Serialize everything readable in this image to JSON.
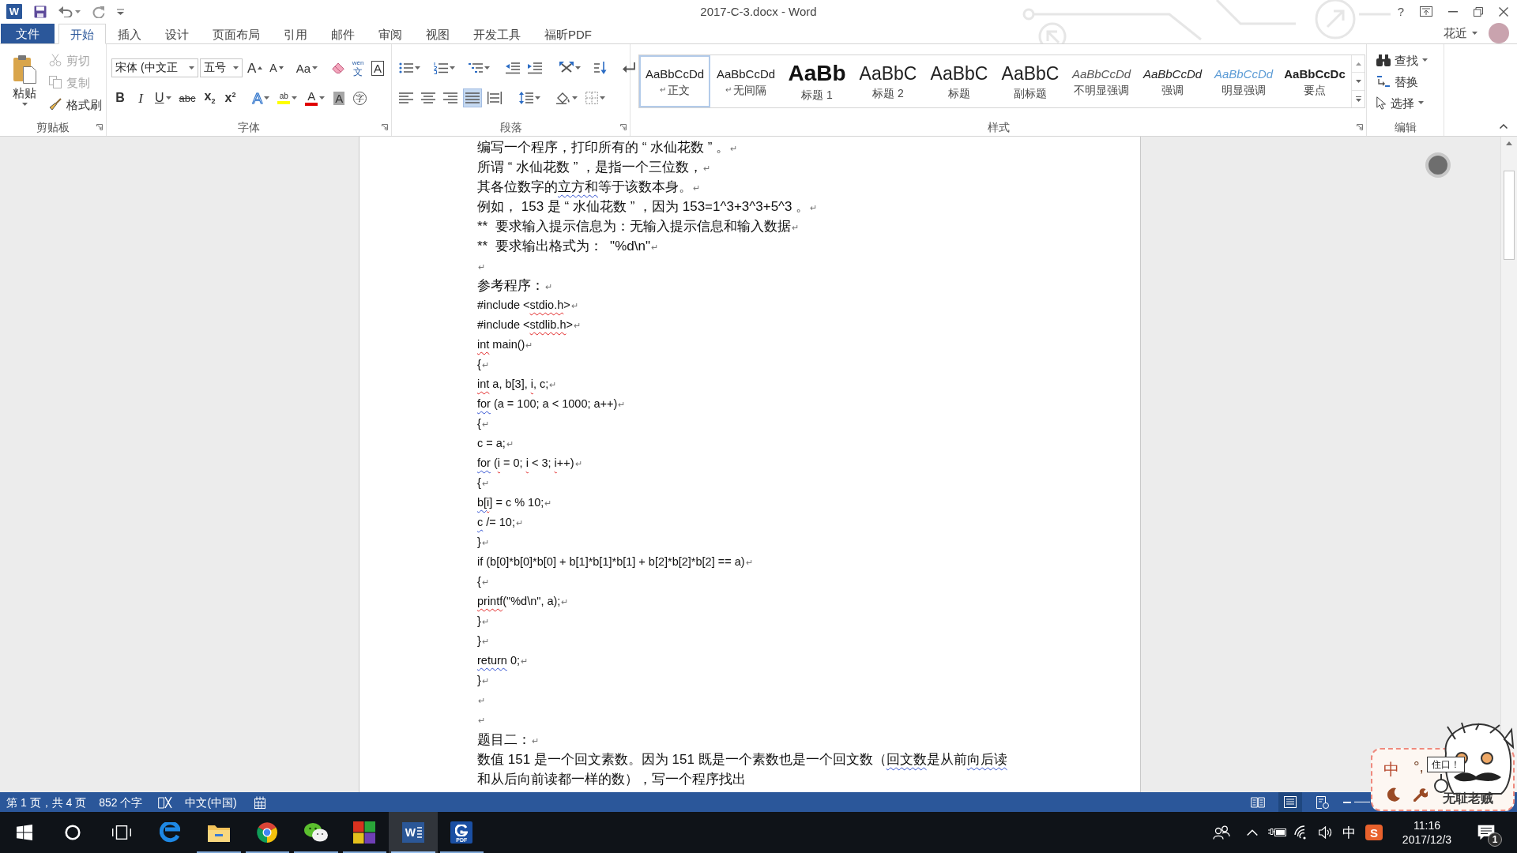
{
  "title_bar": {
    "app_logo": "W",
    "title": "2017-C-3.docx - Word",
    "help": "?"
  },
  "tabs": [
    {
      "label": "文件",
      "kind": "file",
      "selected": false
    },
    {
      "label": "开始",
      "kind": "tab",
      "selected": true
    },
    {
      "label": "插入",
      "kind": "tab",
      "selected": false
    },
    {
      "label": "设计",
      "kind": "tab",
      "selected": false
    },
    {
      "label": "页面布局",
      "kind": "tab",
      "selected": false
    },
    {
      "label": "引用",
      "kind": "tab",
      "selected": false
    },
    {
      "label": "邮件",
      "kind": "tab",
      "selected": false
    },
    {
      "label": "审阅",
      "kind": "tab",
      "selected": false
    },
    {
      "label": "视图",
      "kind": "tab",
      "selected": false
    },
    {
      "label": "开发工具",
      "kind": "tab",
      "selected": false
    },
    {
      "label": "福昕PDF",
      "kind": "tab",
      "selected": false
    }
  ],
  "account": {
    "name": "花近"
  },
  "ribbon": {
    "clipboard": {
      "label": "剪贴板",
      "paste": "粘贴",
      "tools": [
        {
          "kind": "cut",
          "label": "剪切",
          "disabled": true
        },
        {
          "kind": "copy",
          "label": "复制",
          "disabled": true
        },
        {
          "kind": "painter",
          "label": "格式刷",
          "disabled": false
        }
      ]
    },
    "font": {
      "label": "字体",
      "font_name": "宋体 (中文正",
      "font_size": "五号",
      "row_1": [
        {
          "kind": "grow",
          "glyph": "A"
        },
        {
          "kind": "shrink",
          "glyph": "A"
        },
        {
          "kind": "case",
          "glyph": "Aa"
        },
        {
          "kind": "clear"
        },
        {
          "kind": "phonetic",
          "glyph": "文",
          "ruby": "wén"
        },
        {
          "kind": "border",
          "glyph": "A"
        }
      ],
      "row_2": [
        {
          "kind": "bold",
          "glyph": "B"
        },
        {
          "kind": "italic",
          "glyph": "I"
        },
        {
          "kind": "underline",
          "glyph": "U"
        },
        {
          "kind": "strike",
          "glyph": "abc"
        },
        {
          "kind": "subscript",
          "glyph": "x$_{2}$"
        },
        {
          "kind": "superscript",
          "glyph": "x$^{2}$"
        },
        {
          "kind": "effects",
          "glyph": "A"
        },
        {
          "kind": "highlight",
          "glyph": "ab"
        },
        {
          "kind": "color",
          "glyph": "A"
        },
        {
          "kind": "shading",
          "glyph": "A"
        },
        {
          "kind": "enclose",
          "glyph": "字"
        }
      ]
    },
    "paragraph": {
      "label": "段落",
      "alignment": [
        {
          "kind": "left",
          "selected": false
        },
        {
          "kind": "center",
          "selected": false
        },
        {
          "kind": "right",
          "selected": false
        },
        {
          "kind": "justify",
          "selected": true
        },
        {
          "kind": "distributed",
          "selected": false
        }
      ]
    },
    "styles": {
      "label": "样式",
      "items": [
        {
          "preview": "AaBbCcDd",
          "mark": "↵",
          "name": "正文",
          "kind": "normal",
          "selected": true
        },
        {
          "preview": "AaBbCcDd",
          "mark": "↵",
          "name": "无间隔",
          "kind": "normal",
          "selected": false
        },
        {
          "preview": "AaBb",
          "name": "标题 1",
          "kind": "heading1",
          "selected": false
        },
        {
          "preview": "AaBbC",
          "name": "标题 2",
          "kind": "heading2",
          "selected": false
        },
        {
          "preview": "AaBbC",
          "name": "标题",
          "kind": "title",
          "selected": false
        },
        {
          "preview": "AaBbC",
          "name": "副标题",
          "kind": "subtitle",
          "selected": false
        },
        {
          "preview": "AaBbCcDd",
          "name": "不明显强调",
          "kind": "subtle",
          "selected": false
        },
        {
          "preview": "AaBbCcDd",
          "name": "强调",
          "kind": "emphasis",
          "selected": false
        },
        {
          "preview": "AaBbCcDd",
          "name": "明显强调",
          "kind": "intense",
          "selected": false
        },
        {
          "preview": "AaBbCcDc",
          "name": "要点",
          "kind": "strong",
          "selected": false
        }
      ]
    },
    "editing": {
      "label": "编辑",
      "tools": [
        {
          "kind": "find",
          "label": "查找"
        },
        {
          "kind": "replace",
          "label": "替换"
        },
        {
          "kind": "select",
          "label": "选择"
        }
      ]
    }
  },
  "document": {
    "paragraphs": [
      {
        "kind": "prose",
        "runs": [
          {
            "text": "编写一个程序，打印所有的 “ 水仙花数 ” 。",
            "kind": "plain"
          },
          {
            "text": "↵",
            "kind": "mark"
          }
        ]
      },
      {
        "kind": "prose",
        "runs": [
          {
            "text": "所谓 “ 水仙花数 ” ，是指一个三位数，",
            "kind": "plain"
          },
          {
            "text": "↵",
            "kind": "mark"
          }
        ]
      },
      {
        "kind": "prose",
        "runs": [
          {
            "text": "其各位数字的",
            "kind": "plain"
          },
          {
            "text": "立方和",
            "kind": "grammar"
          },
          {
            "text": "等于该数本身。",
            "kind": "plain"
          },
          {
            "text": "↵",
            "kind": "mark"
          }
        ]
      },
      {
        "kind": "prose",
        "runs": [
          {
            "text": "例如， 153 是 “ 水仙花数 ” ，因为 153=1^3+3^3+5^3 。",
            "kind": "plain"
          },
          {
            "text": "↵",
            "kind": "mark"
          }
        ]
      },
      {
        "kind": "prose",
        "runs": [
          {
            "text": "**  要求输入提示信息为：无输入提示信息和输入数据",
            "kind": "plain"
          },
          {
            "text": "↵",
            "kind": "mark"
          }
        ]
      },
      {
        "kind": "prose",
        "runs": [
          {
            "text": "**  要求输出格式为：  \"%d\\n\"",
            "kind": "plain"
          },
          {
            "text": "↵",
            "kind": "mark"
          }
        ]
      },
      {
        "kind": "prose",
        "runs": [
          {
            "text": "↵",
            "kind": "mark"
          }
        ]
      },
      {
        "kind": "prose",
        "runs": [
          {
            "text": "参考程序：",
            "kind": "plain"
          },
          {
            "text": "↵",
            "kind": "mark"
          }
        ]
      },
      {
        "kind": "code",
        "runs": [
          {
            "text": "#include <",
            "kind": "plain"
          },
          {
            "text": "stdio.h",
            "kind": "spelling"
          },
          {
            "text": ">",
            "kind": "plain"
          },
          {
            "text": "↵",
            "kind": "mark"
          }
        ]
      },
      {
        "kind": "code",
        "runs": [
          {
            "text": "#include <",
            "kind": "plain"
          },
          {
            "text": "stdlib.h",
            "kind": "spelling"
          },
          {
            "text": ">",
            "kind": "plain"
          },
          {
            "text": "↵",
            "kind": "mark"
          }
        ]
      },
      {
        "kind": "code",
        "runs": [
          {
            "text": "int",
            "kind": "spelling"
          },
          {
            "text": " main()",
            "kind": "plain"
          },
          {
            "text": "↵",
            "kind": "mark"
          }
        ]
      },
      {
        "kind": "code",
        "runs": [
          {
            "text": "{",
            "kind": "plain"
          },
          {
            "text": "↵",
            "kind": "mark"
          }
        ]
      },
      {
        "kind": "code",
        "runs": [
          {
            "text": "int",
            "kind": "spelling"
          },
          {
            "text": " a, b[3], ",
            "kind": "plain"
          },
          {
            "text": "i",
            "kind": "spelling"
          },
          {
            "text": ", c;",
            "kind": "plain"
          },
          {
            "text": "↵",
            "kind": "mark"
          }
        ]
      },
      {
        "kind": "code",
        "runs": [
          {
            "text": "for",
            "kind": "grammar"
          },
          {
            "text": " (a = 100; a < 1000; a++)",
            "kind": "plain"
          },
          {
            "text": "↵",
            "kind": "mark"
          }
        ]
      },
      {
        "kind": "code",
        "runs": [
          {
            "text": "{",
            "kind": "plain"
          },
          {
            "text": "↵",
            "kind": "mark"
          }
        ]
      },
      {
        "kind": "code",
        "runs": [
          {
            "text": "c = a;",
            "kind": "plain"
          },
          {
            "text": "↵",
            "kind": "mark"
          }
        ]
      },
      {
        "kind": "code",
        "runs": [
          {
            "text": "for",
            "kind": "grammar"
          },
          {
            "text": " (",
            "kind": "plain"
          },
          {
            "text": "i",
            "kind": "spelling"
          },
          {
            "text": " = 0; ",
            "kind": "plain"
          },
          {
            "text": "i",
            "kind": "spelling"
          },
          {
            "text": " < 3; ",
            "kind": "plain"
          },
          {
            "text": "i",
            "kind": "spelling"
          },
          {
            "text": "++)",
            "kind": "plain"
          },
          {
            "text": "↵",
            "kind": "mark"
          }
        ]
      },
      {
        "kind": "code",
        "runs": [
          {
            "text": "{",
            "kind": "plain"
          },
          {
            "text": "↵",
            "kind": "mark"
          }
        ]
      },
      {
        "kind": "code",
        "runs": [
          {
            "text": "b[",
            "kind": "grammar"
          },
          {
            "text": "i",
            "kind": "spelling"
          },
          {
            "text": "] = c % 10;",
            "kind": "plain"
          },
          {
            "text": "↵",
            "kind": "mark"
          }
        ]
      },
      {
        "kind": "code",
        "runs": [
          {
            "text": "c",
            "kind": "grammar"
          },
          {
            "text": " /= 10;",
            "kind": "plain"
          },
          {
            "text": "↵",
            "kind": "mark"
          }
        ]
      },
      {
        "kind": "code",
        "runs": [
          {
            "text": "}",
            "kind": "plain"
          },
          {
            "text": "↵",
            "kind": "mark"
          }
        ]
      },
      {
        "kind": "code",
        "runs": [
          {
            "text": "if (b[0]*b[0]*b[0] + b[1]*b[1]*b[1] + b[2]*b[2]*b[2] == a)",
            "kind": "plain"
          },
          {
            "text": "↵",
            "kind": "mark"
          }
        ]
      },
      {
        "kind": "code",
        "runs": [
          {
            "text": "{",
            "kind": "plain"
          },
          {
            "text": "↵",
            "kind": "mark"
          }
        ]
      },
      {
        "kind": "code",
        "runs": [
          {
            "text": "printf",
            "kind": "spelling"
          },
          {
            "text": "(\"%d\\n\", a);",
            "kind": "plain"
          },
          {
            "text": "↵",
            "kind": "mark"
          }
        ]
      },
      {
        "kind": "code",
        "runs": [
          {
            "text": "}",
            "kind": "plain"
          },
          {
            "text": "↵",
            "kind": "mark"
          }
        ]
      },
      {
        "kind": "code",
        "runs": [
          {
            "text": "}",
            "kind": "plain"
          },
          {
            "text": "↵",
            "kind": "mark"
          }
        ]
      },
      {
        "kind": "code",
        "runs": [
          {
            "text": "return",
            "kind": "grammar"
          },
          {
            "text": " 0;",
            "kind": "plain"
          },
          {
            "text": "↵",
            "kind": "mark"
          }
        ]
      },
      {
        "kind": "code",
        "runs": [
          {
            "text": "}",
            "kind": "plain"
          },
          {
            "text": "↵",
            "kind": "mark"
          }
        ]
      },
      {
        "kind": "code",
        "runs": [
          {
            "text": "↵",
            "kind": "mark"
          }
        ]
      },
      {
        "kind": "code",
        "runs": [
          {
            "text": "↵",
            "kind": "mark"
          }
        ]
      },
      {
        "kind": "prose",
        "runs": [
          {
            "text": "题目二：",
            "kind": "plain"
          },
          {
            "text": "↵",
            "kind": "mark"
          }
        ]
      },
      {
        "kind": "prose",
        "runs": [
          {
            "text": "数值 151 是一个回文素数。因为 151 既是一个素数也是一个回文数（",
            "kind": "plain"
          },
          {
            "text": "回文数",
            "kind": "grammar"
          },
          {
            "text": "是从前",
            "kind": "plain"
          },
          {
            "text": "向后读",
            "kind": "grammar"
          }
        ]
      },
      {
        "kind": "prose",
        "runs": [
          {
            "text": "和从后向前读都一样的数），写一个程序找出",
            "kind": "plain"
          }
        ]
      }
    ]
  },
  "status_bar": {
    "page": "第 1 页，共 4 页",
    "words": "852 个字",
    "language": "中文(中国)",
    "views": [
      {
        "kind": "read",
        "selected": false
      },
      {
        "kind": "print",
        "selected": true
      },
      {
        "kind": "web",
        "selected": false
      }
    ]
  },
  "taskbar": {
    "apps": [
      {
        "kind": "edge",
        "running": false,
        "active": false
      },
      {
        "kind": "explorer",
        "running": true,
        "active": false
      },
      {
        "kind": "chrome",
        "running": true,
        "active": false
      },
      {
        "kind": "wechat",
        "running": true,
        "active": false
      },
      {
        "kind": "tiles",
        "running": true,
        "active": false
      },
      {
        "kind": "word",
        "glyph": "W",
        "running": true,
        "active": true
      },
      {
        "kind": "foxit",
        "glyph": "PDF",
        "running": true,
        "active": false
      }
    ],
    "tray": {
      "ime": "中",
      "ime_logo": "S",
      "time": "11:16",
      "date": "2017/12/3",
      "notifications": "1"
    }
  },
  "ime_toolbar": {
    "mode": "中",
    "punctuation": "°,",
    "sign": "住口！",
    "caption": "无耻老贼"
  }
}
